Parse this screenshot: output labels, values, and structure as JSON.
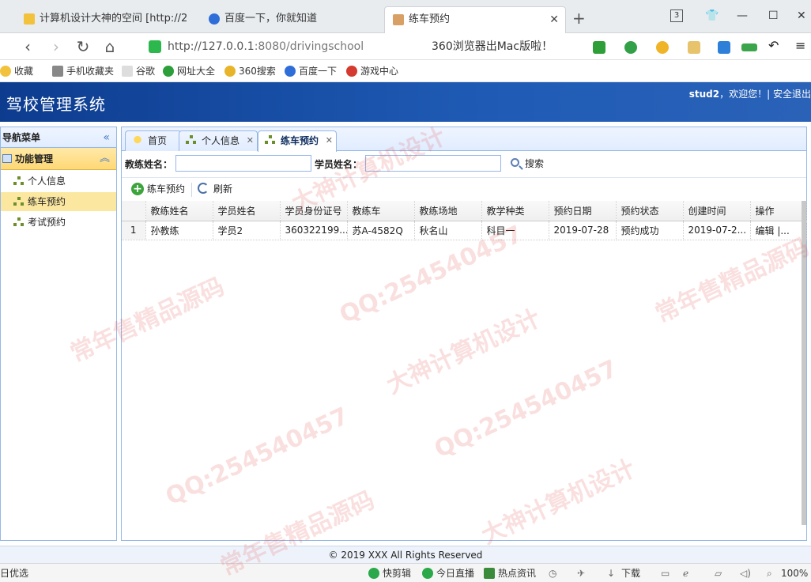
{
  "browser": {
    "tabs": [
      {
        "title": "计算机设计大神的空间 [http://2"
      },
      {
        "title": "百度一下，你就知道"
      },
      {
        "title": "练车预约"
      }
    ],
    "tab_count": "3",
    "url_host": "http://127.0.0.1",
    "url_rest": ":8080/drivingschool",
    "promo": "360浏览器出Mac版啦！",
    "bookmarks": [
      "收藏",
      "手机收藏夹",
      "谷歌",
      "网址大全",
      "360搜索",
      "百度一下",
      "游戏中心"
    ]
  },
  "app": {
    "title": "驾校管理系统",
    "username": "stud2",
    "welcome": "，欢迎您！|",
    "logout": "安全退出"
  },
  "sidebar": {
    "header": "导航菜单",
    "section": "功能管理",
    "items": [
      {
        "label": "个人信息"
      },
      {
        "label": "练车预约"
      },
      {
        "label": "考试预约"
      }
    ]
  },
  "main": {
    "tabs": [
      {
        "label": "首页"
      },
      {
        "label": "个人信息"
      },
      {
        "label": "练车预约"
      }
    ],
    "search": {
      "coach_label": "教练姓名：",
      "student_label": "学员姓名：",
      "button": "搜索"
    },
    "toolbar": {
      "add": "练车预约",
      "refresh": "刷新"
    },
    "table": {
      "columns": [
        "教练姓名",
        "学员姓名",
        "学员身份证号",
        "教练车",
        "教练场地",
        "教学种类",
        "预约日期",
        "预约状态",
        "创建时间",
        "操作"
      ],
      "rows": [
        [
          "1",
          "孙教练",
          "学员2",
          "360322199...",
          "苏A-4582Q",
          "秋名山",
          "科目一",
          "2019-07-28",
          "预约成功",
          "2019-07-2...",
          "编辑 |..."
        ]
      ]
    }
  },
  "footer": "© 2019 XXX All Rights Reserved",
  "statusbar": {
    "left": "日优选",
    "items": [
      "快剪辑",
      "今日直播",
      "热点资讯",
      "下载",
      "100%"
    ]
  },
  "watermarks": [
    "QQ:254540457",
    "常年售精品源码",
    "大神计算机设计"
  ]
}
